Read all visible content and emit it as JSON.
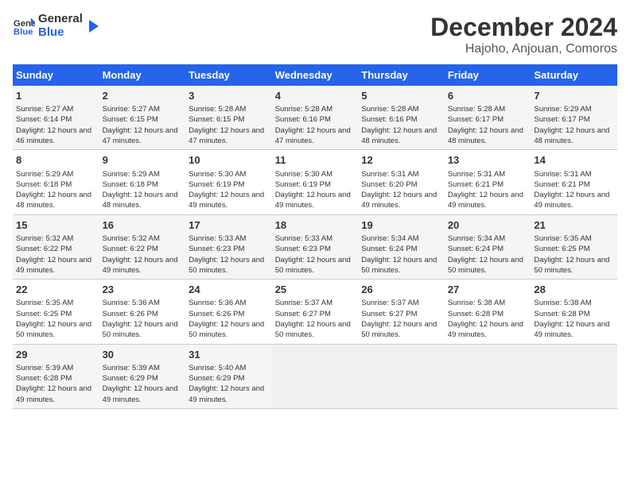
{
  "header": {
    "logo_line1": "General",
    "logo_line2": "Blue",
    "month_year": "December 2024",
    "location": "Hajoho, Anjouan, Comoros"
  },
  "days_of_week": [
    "Sunday",
    "Monday",
    "Tuesday",
    "Wednesday",
    "Thursday",
    "Friday",
    "Saturday"
  ],
  "weeks": [
    [
      {
        "day": 1,
        "sunrise": "5:27 AM",
        "sunset": "6:14 PM",
        "daylight": "12 hours and 46 minutes."
      },
      {
        "day": 2,
        "sunrise": "5:27 AM",
        "sunset": "6:15 PM",
        "daylight": "12 hours and 47 minutes."
      },
      {
        "day": 3,
        "sunrise": "5:28 AM",
        "sunset": "6:15 PM",
        "daylight": "12 hours and 47 minutes."
      },
      {
        "day": 4,
        "sunrise": "5:28 AM",
        "sunset": "6:16 PM",
        "daylight": "12 hours and 47 minutes."
      },
      {
        "day": 5,
        "sunrise": "5:28 AM",
        "sunset": "6:16 PM",
        "daylight": "12 hours and 48 minutes."
      },
      {
        "day": 6,
        "sunrise": "5:28 AM",
        "sunset": "6:17 PM",
        "daylight": "12 hours and 48 minutes."
      },
      {
        "day": 7,
        "sunrise": "5:29 AM",
        "sunset": "6:17 PM",
        "daylight": "12 hours and 48 minutes."
      }
    ],
    [
      {
        "day": 8,
        "sunrise": "5:29 AM",
        "sunset": "6:18 PM",
        "daylight": "12 hours and 48 minutes."
      },
      {
        "day": 9,
        "sunrise": "5:29 AM",
        "sunset": "6:18 PM",
        "daylight": "12 hours and 48 minutes."
      },
      {
        "day": 10,
        "sunrise": "5:30 AM",
        "sunset": "6:19 PM",
        "daylight": "12 hours and 49 minutes."
      },
      {
        "day": 11,
        "sunrise": "5:30 AM",
        "sunset": "6:19 PM",
        "daylight": "12 hours and 49 minutes."
      },
      {
        "day": 12,
        "sunrise": "5:31 AM",
        "sunset": "6:20 PM",
        "daylight": "12 hours and 49 minutes."
      },
      {
        "day": 13,
        "sunrise": "5:31 AM",
        "sunset": "6:21 PM",
        "daylight": "12 hours and 49 minutes."
      },
      {
        "day": 14,
        "sunrise": "5:31 AM",
        "sunset": "6:21 PM",
        "daylight": "12 hours and 49 minutes."
      }
    ],
    [
      {
        "day": 15,
        "sunrise": "5:32 AM",
        "sunset": "6:22 PM",
        "daylight": "12 hours and 49 minutes."
      },
      {
        "day": 16,
        "sunrise": "5:32 AM",
        "sunset": "6:22 PM",
        "daylight": "12 hours and 49 minutes."
      },
      {
        "day": 17,
        "sunrise": "5:33 AM",
        "sunset": "6:23 PM",
        "daylight": "12 hours and 50 minutes."
      },
      {
        "day": 18,
        "sunrise": "5:33 AM",
        "sunset": "6:23 PM",
        "daylight": "12 hours and 50 minutes."
      },
      {
        "day": 19,
        "sunrise": "5:34 AM",
        "sunset": "6:24 PM",
        "daylight": "12 hours and 50 minutes."
      },
      {
        "day": 20,
        "sunrise": "5:34 AM",
        "sunset": "6:24 PM",
        "daylight": "12 hours and 50 minutes."
      },
      {
        "day": 21,
        "sunrise": "5:35 AM",
        "sunset": "6:25 PM",
        "daylight": "12 hours and 50 minutes."
      }
    ],
    [
      {
        "day": 22,
        "sunrise": "5:35 AM",
        "sunset": "6:25 PM",
        "daylight": "12 hours and 50 minutes."
      },
      {
        "day": 23,
        "sunrise": "5:36 AM",
        "sunset": "6:26 PM",
        "daylight": "12 hours and 50 minutes."
      },
      {
        "day": 24,
        "sunrise": "5:36 AM",
        "sunset": "6:26 PM",
        "daylight": "12 hours and 50 minutes."
      },
      {
        "day": 25,
        "sunrise": "5:37 AM",
        "sunset": "6:27 PM",
        "daylight": "12 hours and 50 minutes."
      },
      {
        "day": 26,
        "sunrise": "5:37 AM",
        "sunset": "6:27 PM",
        "daylight": "12 hours and 50 minutes."
      },
      {
        "day": 27,
        "sunrise": "5:38 AM",
        "sunset": "6:28 PM",
        "daylight": "12 hours and 49 minutes."
      },
      {
        "day": 28,
        "sunrise": "5:38 AM",
        "sunset": "6:28 PM",
        "daylight": "12 hours and 49 minutes."
      }
    ],
    [
      {
        "day": 29,
        "sunrise": "5:39 AM",
        "sunset": "6:28 PM",
        "daylight": "12 hours and 49 minutes."
      },
      {
        "day": 30,
        "sunrise": "5:39 AM",
        "sunset": "6:29 PM",
        "daylight": "12 hours and 49 minutes."
      },
      {
        "day": 31,
        "sunrise": "5:40 AM",
        "sunset": "6:29 PM",
        "daylight": "12 hours and 49 minutes."
      },
      null,
      null,
      null,
      null
    ]
  ]
}
